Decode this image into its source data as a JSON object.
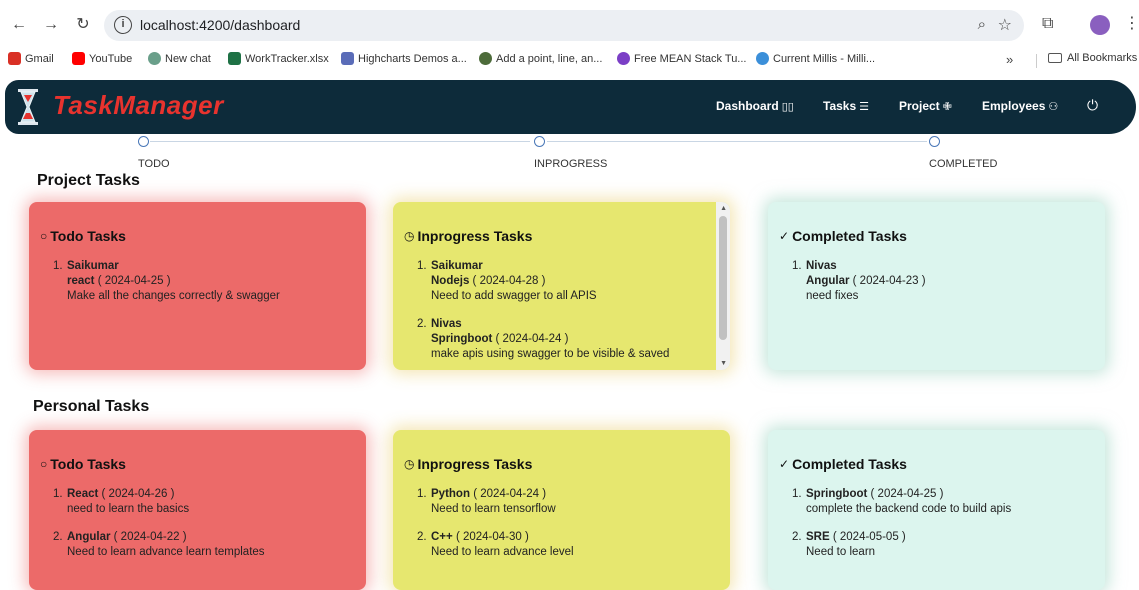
{
  "browser": {
    "url": "localhost:4200/dashboard",
    "bookmarks": [
      {
        "label": "Gmail",
        "icon": "gmail-icon",
        "color": "#d93025"
      },
      {
        "label": "YouTube",
        "icon": "youtube-icon",
        "color": "#ff0000"
      },
      {
        "label": "New chat",
        "icon": "chat-icon",
        "color": "#6a9f8a"
      },
      {
        "label": "WorkTracker.xlsx",
        "icon": "excel-icon",
        "color": "#1e7145"
      },
      {
        "label": "Highcharts Demos a...",
        "icon": "highcharts-icon",
        "color": "#5a6cb8"
      },
      {
        "label": "Add a point, line, an...",
        "icon": "globe-icon",
        "color": "#4d6b3a"
      },
      {
        "label": "Free MEAN Stack Tu...",
        "icon": "udemy-icon",
        "color": "#7b3fc6"
      },
      {
        "label": "Current Millis - Milli...",
        "icon": "clock-icon",
        "color": "#3b8fd9"
      }
    ],
    "more": "»",
    "all_bookmarks": "All Bookmarks"
  },
  "header": {
    "brand": "TaskManager",
    "nav": [
      {
        "label": "Dashboard",
        "icon": "▯▯"
      },
      {
        "label": "Tasks",
        "icon": "☰"
      },
      {
        "label": "Project",
        "icon": "✙"
      },
      {
        "label": "Employees",
        "icon": "⚇"
      }
    ]
  },
  "steps": [
    "TODO",
    "INPROGRESS",
    "COMPLETED"
  ],
  "project": {
    "title": "Project Tasks",
    "todo": {
      "title": "Todo Tasks",
      "tasks": [
        {
          "num": "1.",
          "name": "Saikumar",
          "tech": "react",
          "date": "( 2024-04-25 )",
          "desc": "Make all the changes correctly & swagger"
        }
      ]
    },
    "inprogress": {
      "title": "Inprogress Tasks",
      "tasks": [
        {
          "num": "1.",
          "name": "Saikumar",
          "tech": "Nodejs",
          "date": "( 2024-04-28 )",
          "desc": "Need to add swagger to all APIS"
        },
        {
          "num": "2.",
          "name": "Nivas",
          "tech": "Springboot",
          "date": "( 2024-04-24 )",
          "desc": "make apis using swagger to be visible & saved"
        }
      ]
    },
    "completed": {
      "title": "Completed Tasks",
      "tasks": [
        {
          "num": "1.",
          "name": "Nivas",
          "tech": "Angular",
          "date": "( 2024-04-23 )",
          "desc": "need fixes"
        }
      ]
    }
  },
  "personal": {
    "title": "Personal Tasks",
    "todo": {
      "title": "Todo Tasks",
      "tasks": [
        {
          "num": "1.",
          "name": "React",
          "date": "( 2024-04-26 )",
          "desc": "need to learn the basics"
        },
        {
          "num": "2.",
          "name": "Angular",
          "date": "( 2024-04-22 )",
          "desc": "Need to learn advance learn templates"
        }
      ]
    },
    "inprogress": {
      "title": "Inprogress Tasks",
      "tasks": [
        {
          "num": "1.",
          "name": "Python",
          "date": "( 2024-04-24 )",
          "desc": "Need to learn tensorflow"
        },
        {
          "num": "2.",
          "name": "C++",
          "date": "( 2024-04-30 )",
          "desc": "Need to learn advance level"
        }
      ]
    },
    "completed": {
      "title": "Completed Tasks",
      "tasks": [
        {
          "num": "1.",
          "name": "Springboot",
          "date": "( 2024-04-25 )",
          "desc": "complete the backend code to build apis"
        },
        {
          "num": "2.",
          "name": "SRE",
          "date": "( 2024-05-05 )",
          "desc": "Need to learn"
        }
      ]
    }
  }
}
